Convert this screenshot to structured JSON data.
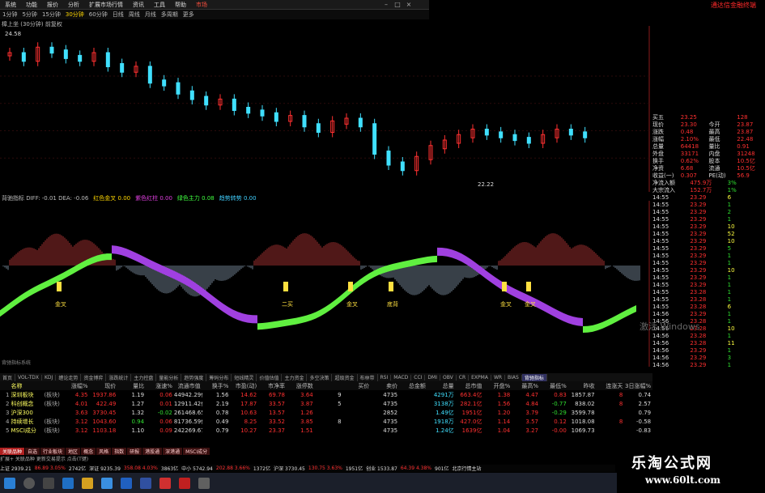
{
  "menubar": {
    "items": [
      "系统",
      "功能",
      "报价",
      "分析",
      "扩展市场行情",
      "资讯",
      "工具",
      "帮助"
    ],
    "active": "市场",
    "right_logo": "通达信金融终端"
  },
  "toolbar": {
    "periods": [
      "1分钟",
      "5分钟",
      "15分钟",
      "30分钟",
      "60分钟",
      "日线",
      "周线",
      "月线",
      "多周期",
      "更多"
    ],
    "selected": "30分钟"
  },
  "main_chart": {
    "label": "樟上坐 (30分钟) 前复权",
    "high_note": "24.58",
    "low_note": "22.22",
    "axis_ticks": [
      "24.00",
      "23.50",
      "23.00",
      "22.50"
    ]
  },
  "indicator": {
    "label": "背驰指标 DIFF: -0.01 DEA: -0.06",
    "legend": [
      {
        "text": "红色金叉 0.00",
        "cls": "y"
      },
      {
        "text": "紫色红柱 0.00",
        "cls": "m"
      },
      {
        "text": "绿色主力 0.08",
        "cls": "g"
      },
      {
        "text": "趋势转势 0.00",
        "cls": "c"
      }
    ],
    "signal_labels": [
      "金叉",
      "二买",
      "金叉",
      "底背",
      "金叉",
      "金叉"
    ],
    "footer": "背驰指标系统"
  },
  "chart_data": {
    "type": "line",
    "x_range": [
      0,
      100
    ],
    "price_series_note": "30-minute candlesticks, red up / cyan down",
    "price_ylim": [
      22.0,
      24.8
    ],
    "price_close": [
      24.4,
      24.3,
      24.5,
      24.45,
      24.35,
      24.3,
      24.4,
      24.2,
      24.1,
      24.15,
      23.9,
      23.85,
      23.7,
      23.6,
      23.5,
      23.55,
      23.4,
      23.35,
      23.3,
      23.2,
      23.25,
      23.1,
      23.0,
      23.15,
      23.2,
      23.1,
      22.6,
      22.4,
      22.3,
      22.5,
      22.7,
      22.8,
      22.9,
      23.0,
      22.95,
      22.9,
      22.85,
      22.8,
      22.9,
      23.0,
      22.95,
      22.9
    ],
    "indicator_ylim": [
      -0.5,
      0.35
    ]
  },
  "tabstrip": [
    "首页",
    "VOL-TDX",
    "KDJ",
    "缠论走势",
    "资金博弈",
    "涨跌统计",
    "主力控盘",
    "量能分析",
    "趋势强度",
    "筹码分布",
    "短线精灵",
    "价值估值",
    "主力资金",
    "多空决策",
    "超级资金",
    "布林带",
    "RSI",
    "MACD",
    "CCI",
    "DMI",
    "OBV",
    "CR",
    "EXPMA",
    "WR",
    "BIAS",
    "背驰指标"
  ],
  "table": {
    "headers": [
      "",
      "名称",
      "",
      "涨幅%",
      "现价",
      "量比",
      "涨速%",
      "流通市值",
      "换手%",
      "市盈(动)",
      "市净率",
      "涨停数",
      "",
      "买价",
      "卖价",
      "总金额",
      "总量",
      "总市值",
      "开盘%",
      "最高%",
      "最低%",
      "昨收",
      "连涨天",
      "3日涨幅%"
    ],
    "rows": [
      {
        "n": "1",
        "name": "深圳板块",
        "tag": "(板块)",
        "v": [
          "4.35",
          "1937.86",
          "1.19",
          "0.06",
          "44942.29亿",
          "1.56",
          "14.62",
          "69.78",
          "3.64",
          "9",
          "",
          "4735",
          "",
          "4291万",
          "663.4亿",
          "1.38",
          "4.47",
          "0.83",
          "1857.87",
          "8",
          "0.74"
        ]
      },
      {
        "n": "2",
        "name": "科创概念",
        "tag": "(板块)",
        "v": [
          "4.01",
          "422.49",
          "1.27",
          "0.01",
          "12911.42亿",
          "2.19",
          "17.87",
          "33.57",
          "3.87",
          "5",
          "",
          "4735",
          "",
          "3138万",
          "282.1亿",
          "1.56",
          "4.84",
          "-0.77",
          "838.02",
          "8",
          "2.57"
        ]
      },
      {
        "n": "3",
        "name": "沪深300",
        "tag": "",
        "v": [
          "3.63",
          "3730.45",
          "1.32",
          "-0.02",
          "261468.65亿",
          "0.78",
          "10.63",
          "13.57",
          "1.26",
          "",
          "",
          "2852",
          "",
          "1.49亿",
          "1951亿",
          "1.20",
          "3.79",
          "-0.29",
          "3599.78",
          "",
          "0.79"
        ]
      },
      {
        "n": "4",
        "name": "持续增长",
        "tag": "(板块)",
        "v": [
          "3.12",
          "1043.60",
          "0.94",
          "0.06",
          "81736.59亿",
          "0.49",
          "8.25",
          "33.52",
          "3.85",
          "8",
          "",
          "4735",
          "",
          "1918万",
          "427.0亿",
          "1.14",
          "3.57",
          "0.12",
          "1018.08",
          "8",
          "-0.58"
        ]
      },
      {
        "n": "5",
        "name": "MSCI成分",
        "tag": "(板块)",
        "v": [
          "3.12",
          "1103.18",
          "1.10",
          "0.09",
          "242269.67亿",
          "0.79",
          "10.27",
          "23.37",
          "1.51",
          "",
          "",
          "4735",
          "",
          "1.24亿",
          "1639亿",
          "1.04",
          "3.27",
          "-0.00",
          "1069.73",
          "",
          "-0.83"
        ]
      }
    ]
  },
  "bottom_tabs": [
    "关联品种",
    "自选",
    "行业板块",
    "地区",
    "概念",
    "风格",
    "指数",
    "研报",
    "港股通",
    "深港通",
    "MSCI成分"
  ],
  "status_text": "扩展+ 关联品种  更新交易提示 点击(T键)",
  "index_strip": [
    {
      "text": "上证 2939.21",
      "cls": "wht"
    },
    {
      "text": "86.89 3.05%",
      "cls": "red"
    },
    {
      "text": "2742亿",
      "cls": "wht"
    },
    {
      "text": "深证 9235.39",
      "cls": "wht"
    },
    {
      "text": "358.08 4.03%",
      "cls": "red"
    },
    {
      "text": "3863亿",
      "cls": "wht"
    },
    {
      "text": "中小 5742.94",
      "cls": "wht"
    },
    {
      "text": "202.88 3.66%",
      "cls": "red"
    },
    {
      "text": "1372亿",
      "cls": "wht"
    },
    {
      "text": "沪深 3730.45",
      "cls": "wht"
    },
    {
      "text": "130.75 3.63%",
      "cls": "red"
    },
    {
      "text": "1951亿",
      "cls": "wht"
    },
    {
      "text": "创业 1533.87",
      "cls": "wht"
    },
    {
      "text": "64.39 4.38%",
      "cls": "red"
    },
    {
      "text": "901亿",
      "cls": "wht"
    },
    {
      "text": "北京行情主站",
      "cls": "wht"
    }
  ],
  "right_panel": {
    "quote_rows": [
      {
        "l": "买五",
        "lv": "23.25",
        "r": "",
        "rv": "128"
      },
      {
        "l": "现价",
        "lv": "23.30",
        "r": "今开",
        "rv": "23.87"
      },
      {
        "l": "涨跌",
        "lv": "0.48",
        "r": "最高",
        "rv": "23.87"
      },
      {
        "l": "涨幅",
        "lv": "2.10%",
        "r": "最低",
        "rv": "22.48"
      },
      {
        "l": "总量",
        "lv": "64418",
        "r": "量比",
        "rv": "0.91"
      },
      {
        "l": "外盘",
        "lv": "33171",
        "r": "内盘",
        "rv": "31248"
      },
      {
        "l": "换手",
        "lv": "0.62%",
        "r": "股本",
        "rv": "10.5亿"
      },
      {
        "l": "净资",
        "lv": "6.68",
        "r": "流通",
        "rv": "10.5亿"
      },
      {
        "l": "收益(一)",
        "lv": "0.307",
        "r": "PE(动)",
        "rv": "56.9"
      }
    ],
    "flow_rows": [
      {
        "l": "净流入额",
        "v": "475.9万",
        "p": "3%"
      },
      {
        "l": "大宗流入",
        "v": "152.7万",
        "p": "1%"
      }
    ],
    "ticks": [
      [
        "14:55",
        "23.29",
        "6"
      ],
      [
        "14:55",
        "23.29",
        "1"
      ],
      [
        "14:55",
        "23.29",
        "2"
      ],
      [
        "14:55",
        "23.29",
        "1"
      ],
      [
        "14:55",
        "23.29",
        "10"
      ],
      [
        "14:55",
        "23.29",
        "52"
      ],
      [
        "14:55",
        "23.29",
        "10"
      ],
      [
        "14:55",
        "23.29",
        "5"
      ],
      [
        "14:55",
        "23.29",
        "1"
      ],
      [
        "14:55",
        "23.29",
        "1"
      ],
      [
        "14:55",
        "23.29",
        "10"
      ],
      [
        "14:55",
        "23.29",
        "1"
      ],
      [
        "14:55",
        "23.29",
        "1"
      ],
      [
        "14:55",
        "23.28",
        "1"
      ],
      [
        "14:55",
        "23.28",
        "1"
      ],
      [
        "14:55",
        "23.28",
        "6"
      ],
      [
        "14:56",
        "23.29",
        "1"
      ],
      [
        "14:56",
        "23.28",
        "1"
      ],
      [
        "14:56",
        "23.28",
        "10"
      ],
      [
        "14:56",
        "23.28",
        "1"
      ],
      [
        "14:56",
        "23.28",
        "11"
      ],
      [
        "14:56",
        "23.29",
        "1"
      ],
      [
        "14:56",
        "23.29",
        "3"
      ],
      [
        "14:56",
        "23.29",
        "1"
      ]
    ]
  },
  "overlay": {
    "activate": "激活 Windows",
    "watermark_cn": "乐淘公式网",
    "watermark_url": "www.60lt.com"
  }
}
